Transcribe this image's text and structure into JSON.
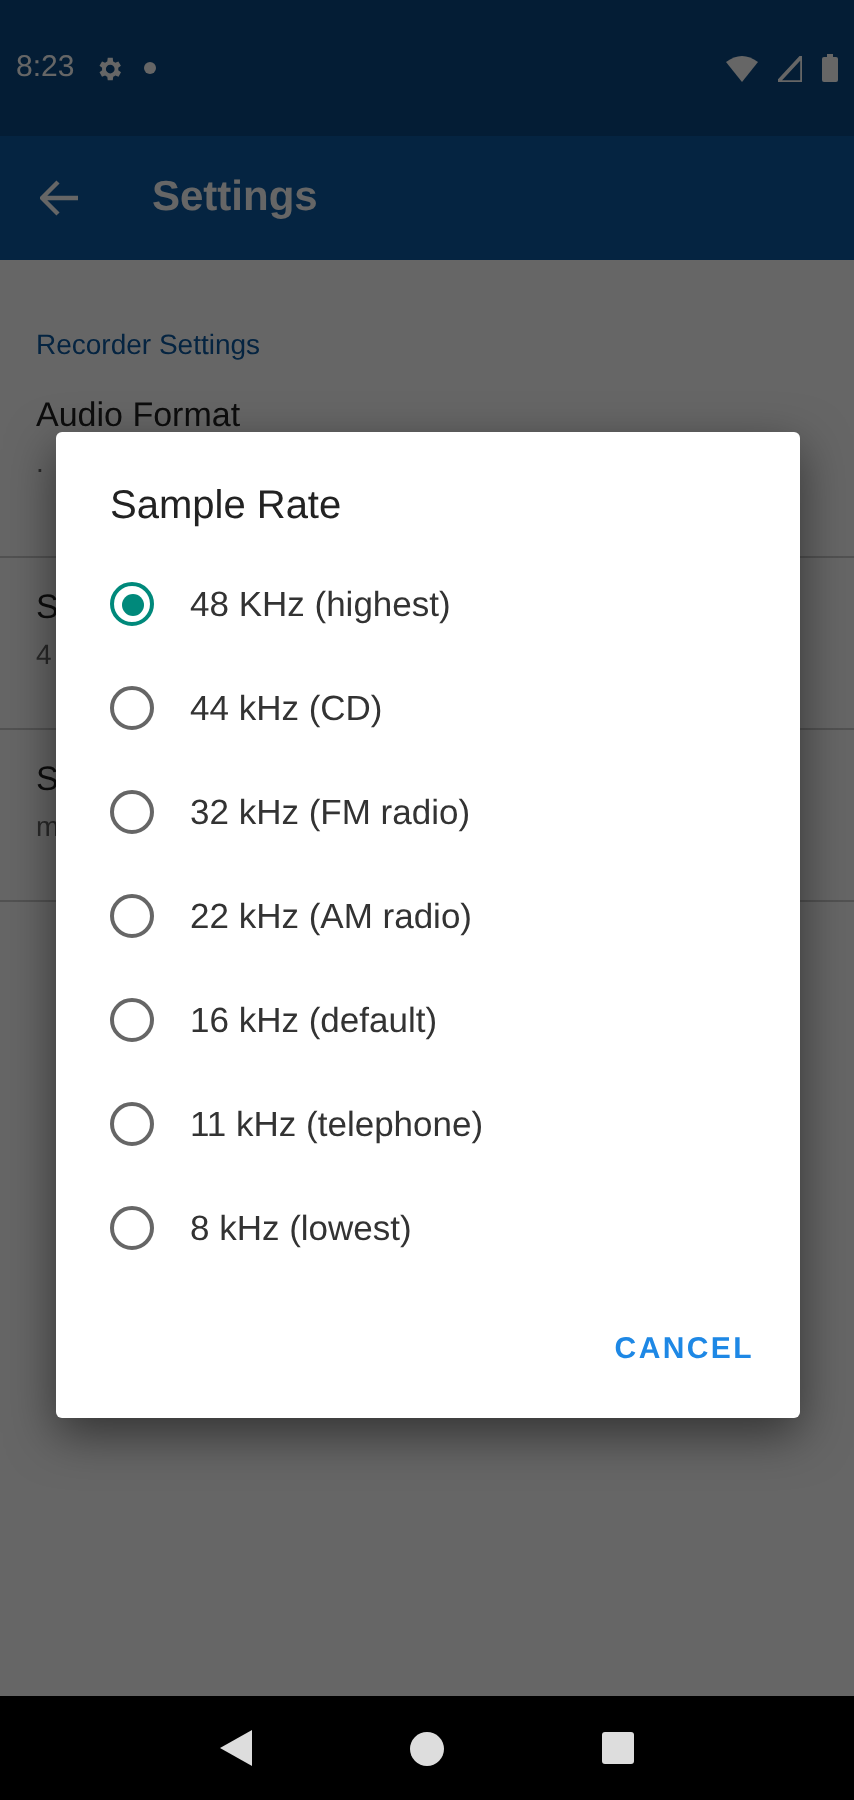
{
  "status_bar": {
    "time": "8:23"
  },
  "app_bar": {
    "title": "Settings"
  },
  "settings": {
    "category": "Recorder Settings",
    "items": [
      {
        "title": "Audio Format",
        "summary": "."
      },
      {
        "title": "S",
        "summary": "4"
      },
      {
        "title": "S",
        "summary": "m"
      }
    ]
  },
  "dialog": {
    "title": "Sample Rate",
    "options": [
      {
        "label": "48 KHz (highest)",
        "selected": true
      },
      {
        "label": "44 kHz (CD)",
        "selected": false
      },
      {
        "label": "32 kHz (FM radio)",
        "selected": false
      },
      {
        "label": "22 kHz (AM radio)",
        "selected": false
      },
      {
        "label": "16 kHz (default)",
        "selected": false
      },
      {
        "label": "11 kHz (telephone)",
        "selected": false
      },
      {
        "label": "8 kHz (lowest)",
        "selected": false
      }
    ],
    "buttons": [
      "CANCEL"
    ]
  }
}
